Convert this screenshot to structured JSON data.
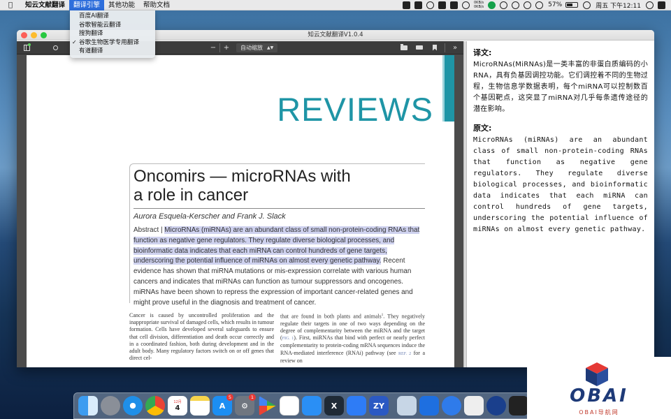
{
  "menubar": {
    "items": [
      "知云文献翻译",
      "翻译引擎",
      "其他功能",
      "帮助文档"
    ],
    "active_index": 1,
    "net_up": "0KB/s",
    "net_down": "0KB/s",
    "battery": "57%",
    "clock": "周五 下午12:11"
  },
  "engine_menu": {
    "items": [
      "百度AI翻译",
      "谷歌智能云翻译",
      "搜狗翻译",
      "谷歌生物医学专用翻译",
      "有道翻译"
    ],
    "checked_index": 3,
    "check_mark": "✓"
  },
  "window": {
    "title": "知云文献翻译V1.0.4"
  },
  "toolbar": {
    "zoom_minus": "−",
    "zoom_plus": "+",
    "zoom_mode": "自动缩放",
    "more": "»"
  },
  "document": {
    "banner": "REVIEWS",
    "title_line1": "Oncomirs — microRNAs with",
    "title_line2": "a role in cancer",
    "authors": "Aurora Esquela-Kerscher and Frank J. Slack",
    "abstract_label": "Abstract",
    "abstract_sep": " | ",
    "abstract_highlighted": "MicroRNAs (miRNAs) are an abundant class of small non-protein-coding RNAs that function as negative gene regulators. They regulate diverse biological processes, and bioinformatic data indicates that each miRNA can control hundreds of gene targets, underscoring the potential influence of miRNAs on almost every genetic pathway.",
    "abstract_rest": " Recent evidence has shown that miRNA mutations or mis-expression correlate with various human cancers and indicates that miRNAs can function as tumour suppressors and oncogenes. miRNAs have been shown to repress the expression of important cancer-related genes and might prove useful in the diagnosis and treatment of cancer.",
    "body_left": "Cancer is caused by uncontrolled proliferation and the inappropriate survival of damaged cells, which results in tumour formation. Cells have developed several safeguards to ensure that cell division, differentiation and death occur correctly and in a coordinated fashion, both during development and in the adult body. Many regulatory factors switch on or off genes that direct cel-",
    "body_right_a": "that are found in both plants and animals",
    "body_right_sup": "1",
    "body_right_b": ". They negatively regulate their targets in one of two ways depending on the degree of complementarity between the miRNA and the target (",
    "body_right_ref1": "FIG. 1",
    "body_right_c": "). First, miRNAs that bind with perfect or nearly perfect complementarity to protein-coding mRNA sequences induce the RNA-mediated interference (RNAi) pathway (see ",
    "body_right_ref2": "REF. 2",
    "body_right_d": " for a review on"
  },
  "translation": {
    "heading_translated": "译文:",
    "translated_text": "MicroRNAs(MiRNAs)是一类丰富的非蛋白质编码的小RNA，具有负基因调控功能。它们调控着不同的生物过程，生物信息学数据表明，每个miRNA可以控制数百个基因靶点，这突显了miRNA对几乎每条遗传途径的潜在影响。",
    "heading_original": "原文:",
    "original_text": "MicroRNAs (miRNAs) are an abundant class of small non-protein-coding RNAs that function as negative gene regulators. They regulate diverse biological processes, and bioinformatic data indicates that each miRNA can control hundreds of gene targets, underscoring the potential influence of miRNAs on almost every genetic pathway."
  },
  "dock": {
    "calendar_day": "4",
    "calendar_month": "12月",
    "appstore_badge": "5",
    "prefs_badge": "1",
    "zy_label": "ZY"
  },
  "watermark": {
    "brand": "OBAI",
    "subtitle": "OBAI导航网"
  },
  "colors": {
    "accent_teal": "#1f95a6",
    "highlight": "#cfd2ef",
    "menu_active": "#2f6fdc"
  }
}
